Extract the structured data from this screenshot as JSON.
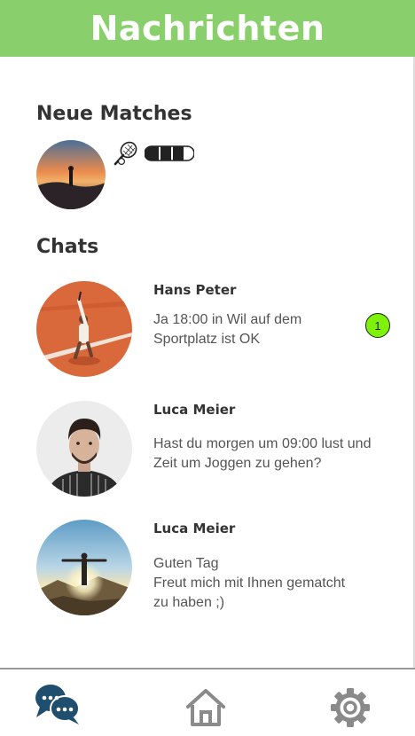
{
  "header": {
    "title": "Nachrichten"
  },
  "matches": {
    "title": "Neue Matches",
    "items": [
      {
        "sport_icon": "tennis-racket-icon",
        "level_icon": "level-bar-icon",
        "level_filled": 3,
        "level_total": 4
      }
    ]
  },
  "chats": {
    "title": "Chats",
    "items": [
      {
        "name": "Hans Peter",
        "message": "Ja 18:00 in Wil auf dem\nSportplatz ist OK",
        "unread": "1"
      },
      {
        "name": "Luca Meier",
        "message": "Hast du morgen um 09:00 lust und\nZeit um Joggen zu gehen?"
      },
      {
        "name": "Luca Meier",
        "message": "Guten Tag\nFreut mich mit Ihnen gematcht\nzu haben ;)"
      }
    ]
  },
  "nav": {
    "items": [
      {
        "icon": "chat-bubbles-icon",
        "active": true,
        "color": "#1f4e6e"
      },
      {
        "icon": "home-icon",
        "active": false,
        "color": "#8a8a8a"
      },
      {
        "icon": "gear-icon",
        "active": false,
        "color": "#8a8a8a"
      }
    ]
  },
  "colors": {
    "header_bg": "#89d06c",
    "unread_badge": "#7ef20b",
    "active_nav": "#1f4e6e"
  }
}
